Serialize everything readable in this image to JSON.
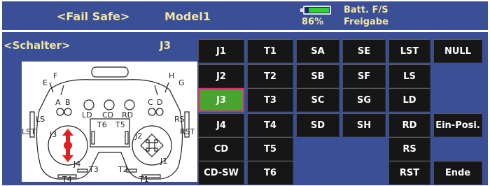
{
  "header": {
    "title": "<Fail Safe>",
    "model": "Model1",
    "battery_percent": "86%",
    "battery_level": 0.86,
    "fs_line1": "Batt. F/S",
    "fs_line2": "Freigabe"
  },
  "panel": {
    "switch_label": "<Schalter>",
    "current_value": "J3"
  },
  "buttons": [
    [
      "J1",
      "T1",
      "SA",
      "SE",
      "LST",
      "NULL"
    ],
    [
      "J2",
      "T2",
      "SB",
      "SF",
      "LS",
      ""
    ],
    [
      "J3",
      "T3",
      "SC",
      "SG",
      "LD",
      ""
    ],
    [
      "J4",
      "T4",
      "SD",
      "SH",
      "RD",
      "Ein-Posi."
    ],
    [
      "CD",
      "T5",
      "",
      "",
      "RS",
      ""
    ],
    [
      "CD-SW",
      "T6",
      "",
      "",
      "RST",
      "Ende"
    ]
  ],
  "selected": "J3",
  "diagram": {
    "labels": [
      "E",
      "F",
      "A",
      "B",
      "H",
      "G",
      "C",
      "D",
      "LD",
      "CD",
      "RD",
      "LS",
      "LST",
      "RS",
      "RST",
      "T6",
      "T5",
      "J3",
      "J4",
      "J2",
      "J1",
      "T3",
      "T2",
      "T4",
      "T1"
    ],
    "highlight_color": "#e02020"
  }
}
